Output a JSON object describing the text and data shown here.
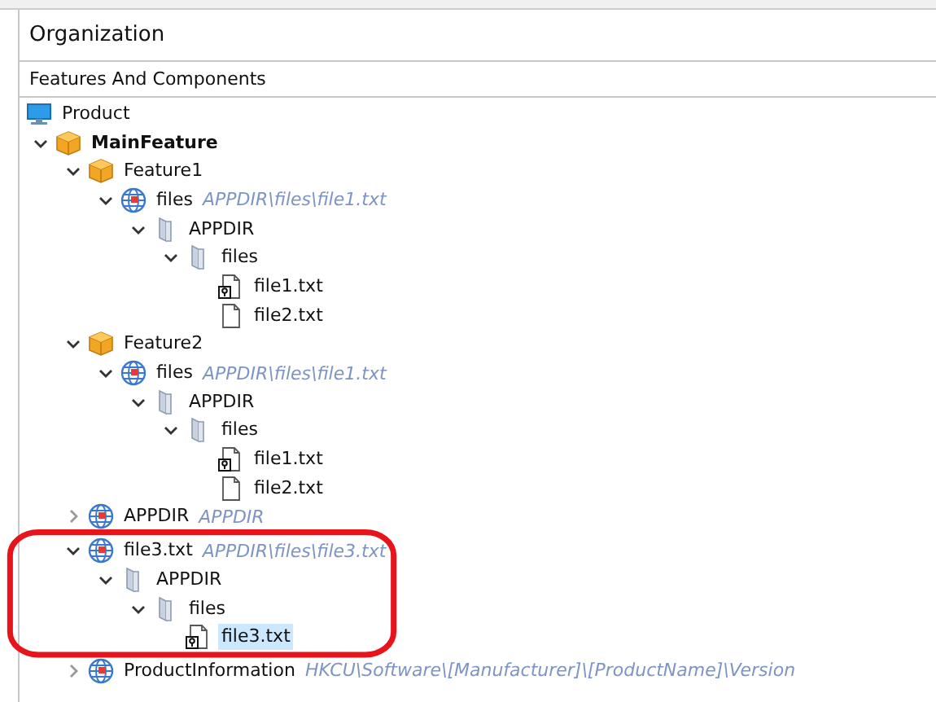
{
  "panel": {
    "title": "Organization",
    "section": "Features And Components"
  },
  "tree": [
    {
      "label": "Product",
      "kind": "product",
      "selected": false
    },
    {
      "label": "MainFeature",
      "kind": "main-feature",
      "expanded": true,
      "selected": false,
      "children": [
        {
          "label": "Feature1",
          "kind": "feature",
          "expanded": true,
          "selected": false,
          "children": [
            {
              "label": "files",
              "path": "APPDIR\\files\\file1.txt",
              "kind": "component",
              "expanded": true,
              "selected": false,
              "children": [
                {
                  "label": "APPDIR",
                  "kind": "folder",
                  "expanded": true,
                  "selected": false,
                  "children": [
                    {
                      "label": "files",
                      "kind": "folder",
                      "expanded": true,
                      "selected": false,
                      "children": [
                        {
                          "label": "file1.txt",
                          "kind": "keyfile",
                          "selected": false
                        },
                        {
                          "label": "file2.txt",
                          "kind": "file",
                          "selected": false
                        }
                      ]
                    }
                  ]
                }
              ]
            }
          ]
        },
        {
          "label": "Feature2",
          "kind": "feature",
          "expanded": true,
          "selected": false,
          "children": [
            {
              "label": "files",
              "path": "APPDIR\\files\\file1.txt",
              "kind": "component",
              "expanded": true,
              "selected": false,
              "children": [
                {
                  "label": "APPDIR",
                  "kind": "folder",
                  "expanded": true,
                  "selected": false,
                  "children": [
                    {
                      "label": "files",
                      "kind": "folder",
                      "expanded": true,
                      "selected": false,
                      "children": [
                        {
                          "label": "file1.txt",
                          "kind": "keyfile",
                          "selected": false
                        },
                        {
                          "label": "file2.txt",
                          "kind": "file",
                          "selected": false
                        }
                      ]
                    }
                  ]
                }
              ]
            }
          ]
        },
        {
          "label": "APPDIR",
          "path": "APPDIR",
          "kind": "component",
          "expanded": false,
          "selected": false
        },
        {
          "label": "file3.txt",
          "path": "APPDIR\\files\\file3.txt",
          "kind": "component",
          "expanded": true,
          "selected": false,
          "circled": true,
          "children": [
            {
              "label": "APPDIR",
              "kind": "folder",
              "expanded": true,
              "selected": false,
              "children": [
                {
                  "label": "files",
                  "kind": "folder",
                  "expanded": true,
                  "selected": false,
                  "children": [
                    {
                      "label": "file3.txt",
                      "kind": "keyfile",
                      "selected": true
                    }
                  ]
                }
              ]
            }
          ]
        },
        {
          "label": "ProductInformation",
          "path": "HKCU\\Software\\[Manufacturer]\\[ProductName]\\Version",
          "kind": "component",
          "expanded": false,
          "selected": false
        }
      ]
    }
  ]
}
